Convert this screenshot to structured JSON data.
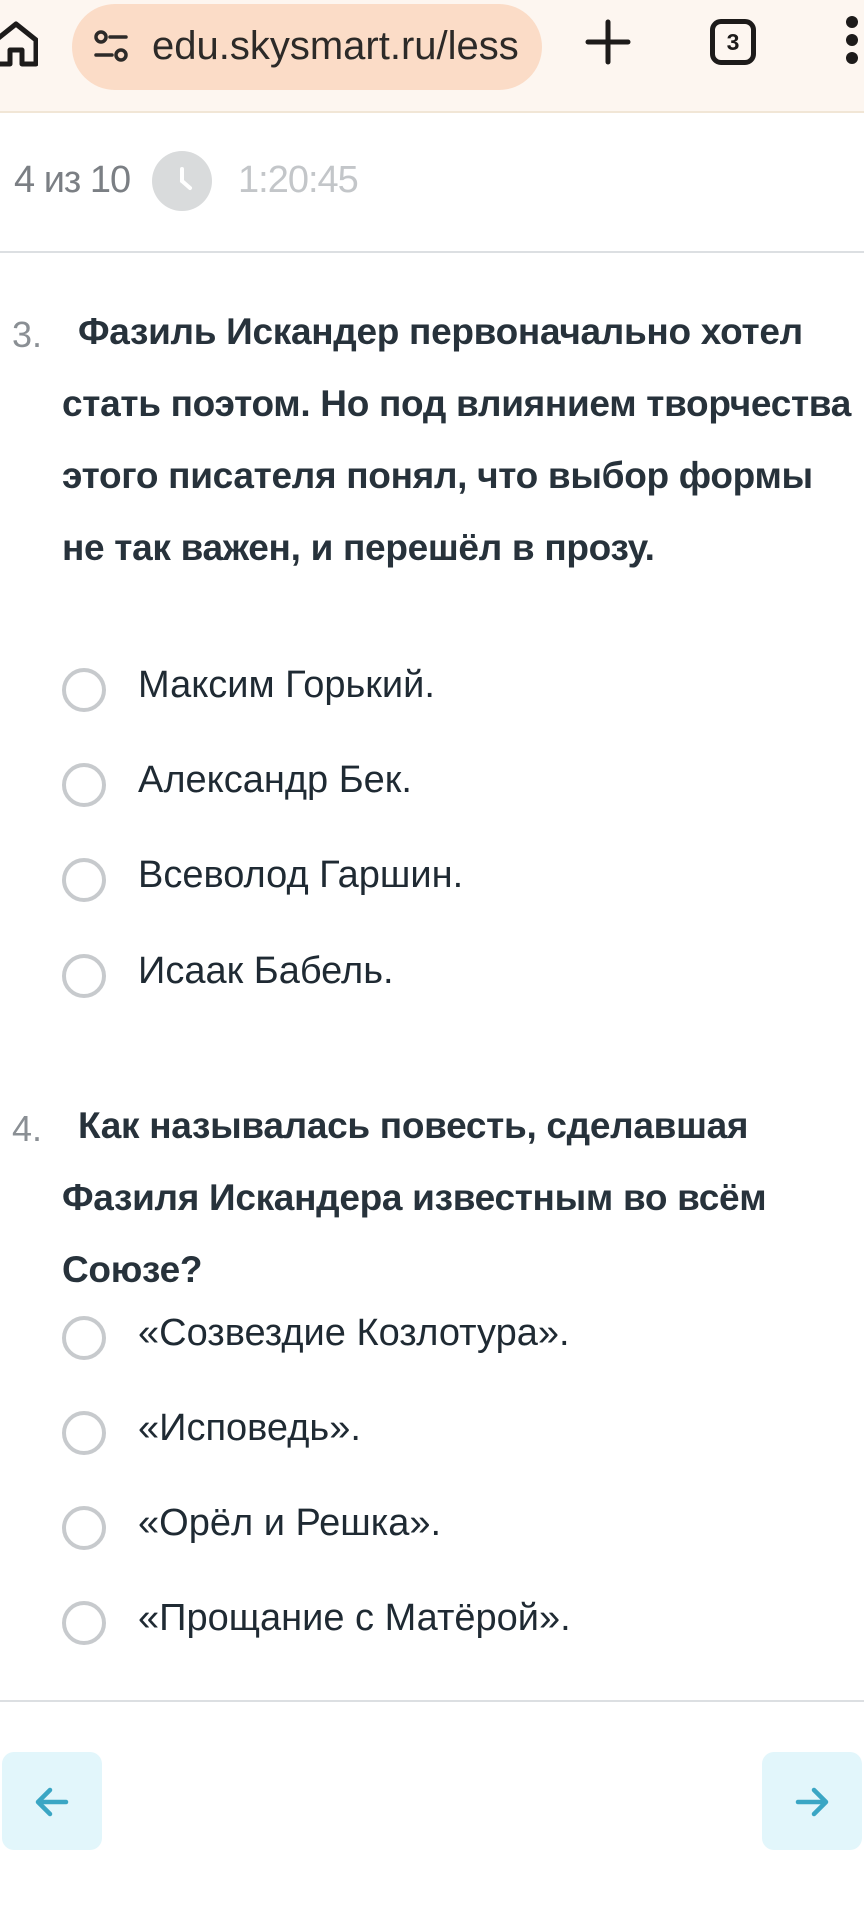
{
  "browser": {
    "url": "edu.skysmart.ru/less",
    "tab_count": "3",
    "icons": [
      "home-icon",
      "tune-icon",
      "plus-icon",
      "tabs-icon",
      "more-vert-icon"
    ]
  },
  "progress": {
    "position": "4 из 10",
    "timer": "1:20:45",
    "icon": "clock-icon"
  },
  "questions": [
    {
      "number": "3.",
      "text": "Фазиль Искандер первоначально хотел стать поэтом. Но под влиянием творчества этого писателя понял, что выбор формы не так важен, и перешёл в прозу.",
      "options": [
        "Максим Горький.",
        "Александр Бек.",
        "Всеволод Гаршин.",
        "Исаак Бабель."
      ]
    },
    {
      "number": "4.",
      "text": "Как называлась повесть, сделавшая Фазиля Искандера известным во всём Союзе?",
      "options": [
        "«Созвездие Козлотура».",
        "«Исповедь».",
        "«Орёл и Решка».",
        "«Прощание с Матёрой»."
      ]
    }
  ],
  "navigation": {
    "prev_icon": "arrow-left-icon",
    "next_icon": "arrow-right-icon",
    "accent": "#3aa6c4"
  }
}
